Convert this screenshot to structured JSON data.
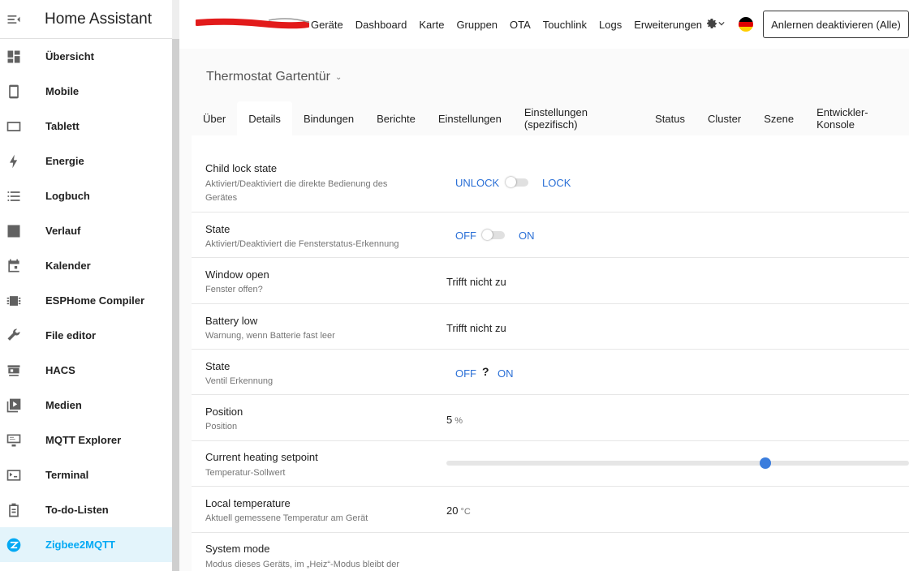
{
  "sidebar": {
    "title": "Home Assistant",
    "items": [
      {
        "label": "Übersicht",
        "icon": "dashboard-icon"
      },
      {
        "label": "Mobile",
        "icon": "phone-icon"
      },
      {
        "label": "Tablett",
        "icon": "tablet-icon"
      },
      {
        "label": "Energie",
        "icon": "lightning-icon"
      },
      {
        "label": "Logbuch",
        "icon": "list-icon"
      },
      {
        "label": "Verlauf",
        "icon": "chart-icon"
      },
      {
        "label": "Kalender",
        "icon": "calendar-icon"
      },
      {
        "label": "ESPHome Compiler",
        "icon": "chip-icon"
      },
      {
        "label": "File editor",
        "icon": "wrench-icon"
      },
      {
        "label": "HACS",
        "icon": "hacs-icon"
      },
      {
        "label": "Medien",
        "icon": "media-icon"
      },
      {
        "label": "MQTT Explorer",
        "icon": "monitor-icon"
      },
      {
        "label": "Terminal",
        "icon": "terminal-icon"
      },
      {
        "label": "To-do-Listen",
        "icon": "clipboard-icon"
      },
      {
        "label": "Zigbee2MQTT",
        "icon": "zigbee-icon",
        "active": true
      }
    ]
  },
  "topbar": {
    "nav": [
      "Geräte",
      "Dashboard",
      "Karte",
      "Gruppen",
      "OTA",
      "Touchlink",
      "Logs",
      "Erweiterungen"
    ],
    "permit_join_label": "Anlernen deaktivieren (Alle)"
  },
  "device": {
    "title": "Thermostat Gartentür"
  },
  "tabs": [
    "Über",
    "Details",
    "Bindungen",
    "Berichte",
    "Einstellungen",
    "Einstellungen (spezifisch)",
    "Status",
    "Cluster",
    "Szene",
    "Entwickler-Konsole"
  ],
  "active_tab": "Details",
  "rows": {
    "child_lock": {
      "name": "Child lock state",
      "desc": "Aktiviert/Deaktiviert die direkte Bedienung des Gerätes",
      "off": "UNLOCK",
      "on": "LOCK"
    },
    "state_window": {
      "name": "State",
      "desc": "Aktiviert/Deaktiviert die Fensterstatus-Erkennung",
      "off": "OFF",
      "on": "ON"
    },
    "window_open": {
      "name": "Window open",
      "desc": "Fenster offen?",
      "value": "Trifft nicht zu"
    },
    "battery_low": {
      "name": "Battery low",
      "desc": "Warnung, wenn Batterie fast leer",
      "value": "Trifft nicht zu"
    },
    "state_valve": {
      "name": "State",
      "desc": "Ventil Erkennung",
      "off": "OFF",
      "unknown": "?",
      "on": "ON"
    },
    "position": {
      "name": "Position",
      "desc": "Position",
      "value": "5",
      "unit": "%"
    },
    "setpoint": {
      "name": "Current heating setpoint",
      "desc": "Temperatur-Sollwert",
      "slider_fraction": 0.69
    },
    "local_temp": {
      "name": "Local temperature",
      "desc": "Aktuell gemessene Temperatur am Gerät",
      "value": "20",
      "unit": "°C"
    },
    "system_mode": {
      "name": "System mode",
      "desc": "Modus dieses Geräts, im „Heiz“-Modus bleibt der"
    }
  },
  "colors": {
    "accent": "#03a9f4",
    "toggle_label": "#2a6fd6",
    "slider": "#3b7ddd"
  }
}
